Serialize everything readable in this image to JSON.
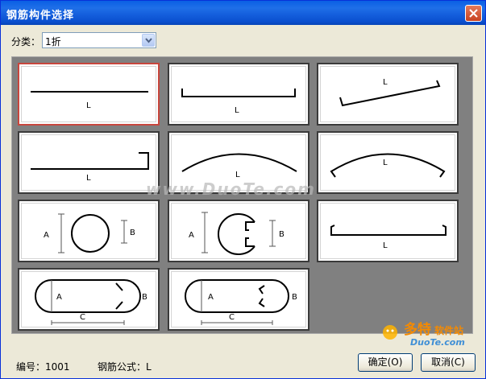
{
  "window": {
    "title": "钢筋构件选择"
  },
  "category": {
    "label": "分类：",
    "value": "1折"
  },
  "shapes": {
    "label_L": "L",
    "label_A": "A",
    "label_B": "B",
    "label_C": "C"
  },
  "watermark": "www.DuoTe.com",
  "brand": {
    "name": "多特",
    "suffix": "软件站",
    "url": "DuoTe.com"
  },
  "footer": {
    "code": "编号：1001",
    "formula": "钢筋公式：L",
    "ok_label": "确定(O)",
    "cancel_label": "取消(C)"
  }
}
